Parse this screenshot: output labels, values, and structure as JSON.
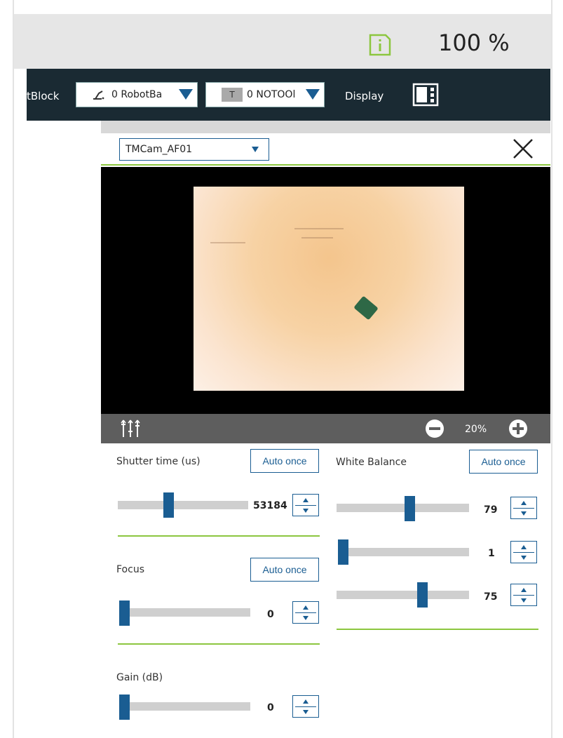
{
  "status": {
    "zoom_percent": "100 %",
    "info_icon": "info-document-icon"
  },
  "toolbar": {
    "block_label": "tBlock",
    "robot_base": {
      "icon": "robot-arm-icon",
      "text": "0 RobotBa"
    },
    "tool": {
      "badge": "T",
      "text": "0 NOTOOl"
    },
    "display_label": "Display",
    "layout_icon": "layout-panel-icon"
  },
  "camera": {
    "selected": "TMCam_AF01",
    "close_icon": "close-icon"
  },
  "viewer": {
    "zoom_value": "20%",
    "settings_icon": "sliders-icon",
    "zoom_out_icon": "zoom-out-icon",
    "zoom_in_icon": "zoom-in-icon"
  },
  "controls": {
    "shutter": {
      "label": "Shutter time (us)",
      "auto": "Auto once",
      "value": "53184",
      "level": 0.38
    },
    "focus": {
      "label": "Focus",
      "auto": "Auto once",
      "value": "0",
      "level": 0.0
    },
    "gain": {
      "label": "Gain (dB)",
      "value": "0",
      "level": 0.0
    },
    "white_balance": {
      "label": "White Balance",
      "auto": "Auto once",
      "channels": [
        {
          "value": "79",
          "level": 0.56
        },
        {
          "value": "1",
          "level": 0.0
        },
        {
          "value": "75",
          "level": 0.66
        }
      ]
    }
  },
  "colors": {
    "toolbar_bg": "#1a2a33",
    "accent_blue": "#1a5d92",
    "accent_green": "#8cc63f"
  }
}
